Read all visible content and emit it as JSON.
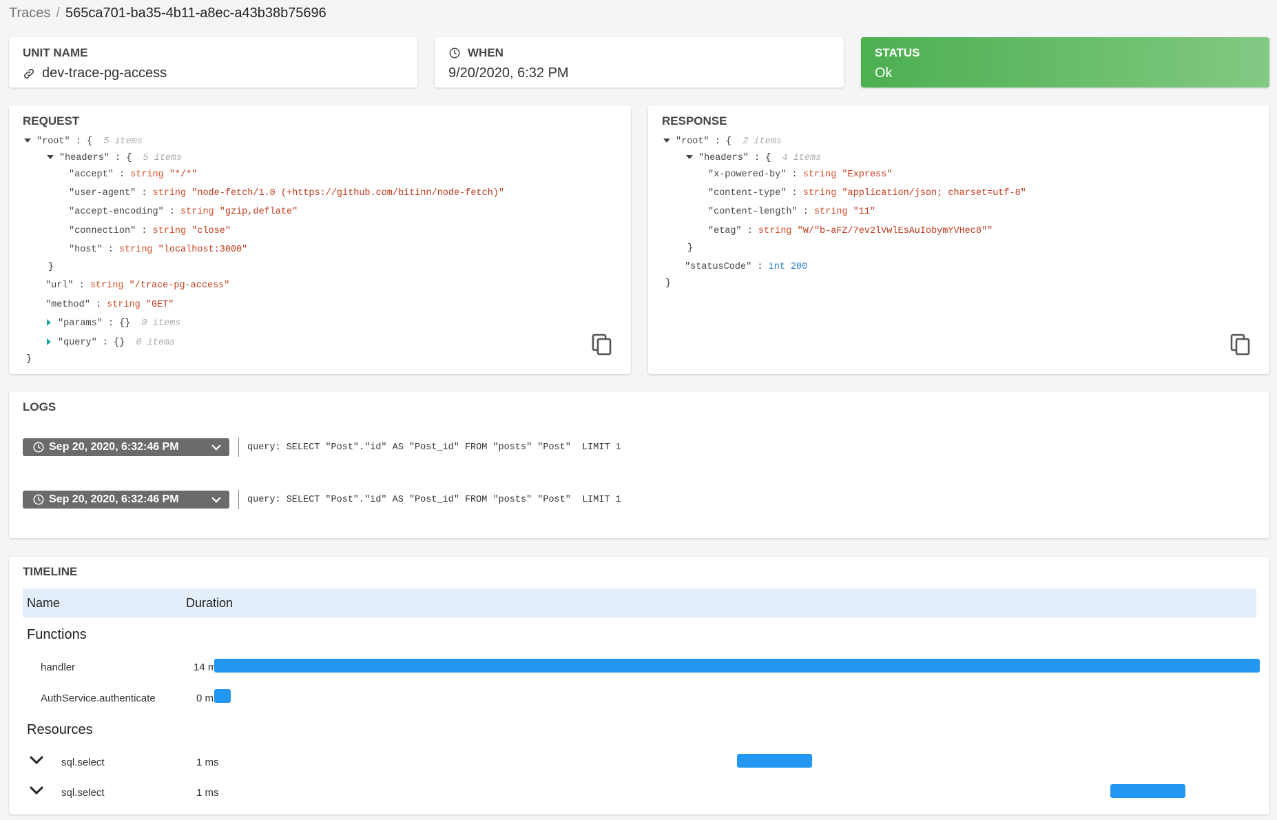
{
  "breadcrumb": {
    "parent": "Traces",
    "separator": "/",
    "current": "565ca701-ba35-4b11-a8ec-a43b38b75696"
  },
  "summary": {
    "unit_name": {
      "label": "UNIT NAME",
      "value": "dev-trace-pg-access",
      "icon": "link-icon"
    },
    "when": {
      "label": "WHEN",
      "value": "9/20/2020, 6:32 PM",
      "icon": "clock-icon"
    },
    "status": {
      "label": "STATUS",
      "value": "Ok",
      "color_start": "#4caf50",
      "color_end": "#82c983"
    }
  },
  "request": {
    "title": "REQUEST",
    "root_key": "\"root\"",
    "root_count": "5 items",
    "headers_key": "\"headers\"",
    "headers_count": "5 items",
    "headers": [
      {
        "key": "\"accept\"",
        "type": "string",
        "value": "\"*/*\""
      },
      {
        "key": "\"user-agent\"",
        "type": "string",
        "value": "\"node-fetch/1.0 (+https://github.com/bitinn/node-fetch)\""
      },
      {
        "key": "\"accept-encoding\"",
        "type": "string",
        "value": "\"gzip,deflate\""
      },
      {
        "key": "\"connection\"",
        "type": "string",
        "value": "\"close\""
      },
      {
        "key": "\"host\"",
        "type": "string",
        "value": "\"localhost:3000\""
      }
    ],
    "url": {
      "key": "\"url\"",
      "type": "string",
      "value": "\"/trace-pg-access\""
    },
    "method": {
      "key": "\"method\"",
      "type": "string",
      "value": "\"GET\""
    },
    "params": {
      "key": "\"params\"",
      "value": "{}",
      "count": "0 items"
    },
    "query": {
      "key": "\"query\"",
      "value": "{}",
      "count": "0 items"
    }
  },
  "response": {
    "title": "RESPONSE",
    "root_key": "\"root\"",
    "root_count": "2 items",
    "headers_key": "\"headers\"",
    "headers_count": "4 items",
    "headers": [
      {
        "key": "\"x-powered-by\"",
        "type": "string",
        "value": "\"Express\""
      },
      {
        "key": "\"content-type\"",
        "type": "string",
        "value": "\"application/json; charset=utf-8\""
      },
      {
        "key": "\"content-length\"",
        "type": "string",
        "value": "\"11\""
      },
      {
        "key": "\"etag\"",
        "type": "string",
        "value": "\"W/\"b-aFZ/7ev2lVwlEsAuIobymYVHec8\"\""
      }
    ],
    "statusCode": {
      "key": "\"statusCode\"",
      "type": "int",
      "value": "200"
    }
  },
  "logs": {
    "title": "LOGS",
    "entries": [
      {
        "time": "Sep 20, 2020, 6:32:46 PM",
        "message": "query: SELECT \"Post\".\"id\" AS \"Post_id\" FROM \"posts\" \"Post\"  LIMIT 1"
      },
      {
        "time": "Sep 20, 2020, 6:32:46 PM",
        "message": "query: SELECT \"Post\".\"id\" AS \"Post_id\" FROM \"posts\" \"Post\"  LIMIT 1"
      }
    ]
  },
  "timeline": {
    "title": "TIMELINE",
    "col_name": "Name",
    "col_duration": "Duration",
    "bar_color": "#2196f3",
    "functions_label": "Functions",
    "resources_label": "Resources",
    "functions": [
      {
        "name": "handler",
        "duration": "14 ms",
        "start_fraction": 0.0,
        "width_fraction": 1.0
      },
      {
        "name": "AuthService.authenticate",
        "duration": "0 ms",
        "start_fraction": 0.0,
        "width_fraction": 0.016
      }
    ],
    "resources": [
      {
        "name": "sql.select",
        "duration": "1 ms",
        "start_fraction": 0.5,
        "width_fraction": 0.072
      },
      {
        "name": "sql.select",
        "duration": "1 ms",
        "start_fraction": 0.857,
        "width_fraction": 0.072
      }
    ]
  }
}
